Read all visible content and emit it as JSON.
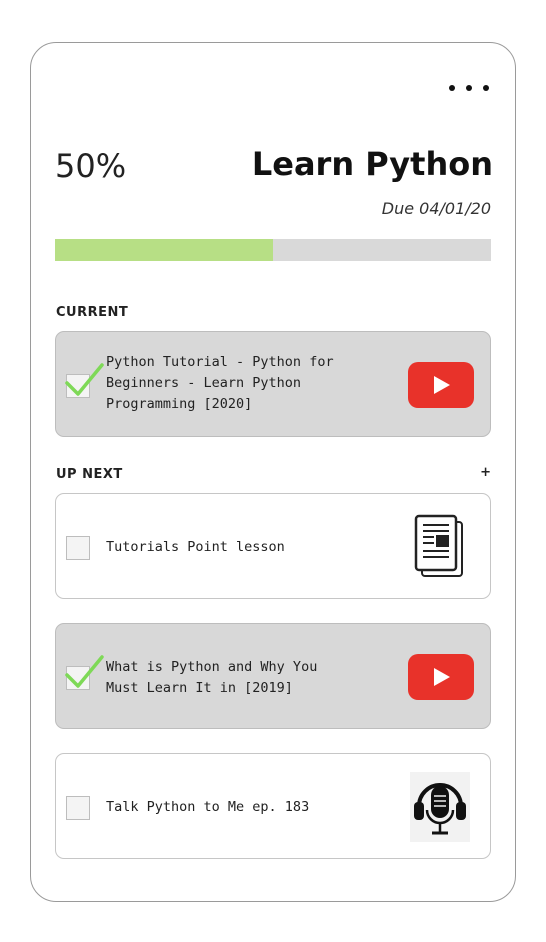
{
  "goal": {
    "progress_label": "50%",
    "progress_fraction": 0.5,
    "title": "Learn Python",
    "due": "Due 04/01/20"
  },
  "colors": {
    "progress_fill": "#b7df85",
    "progress_track": "#d9d9d9",
    "completed_item_bg": "#d8d8d8",
    "checkmark": "#7ed957",
    "youtube_red": "#e8322a"
  },
  "menu": {
    "icon": "more-horizontal-icon"
  },
  "current": {
    "label": "CURRENT",
    "item": {
      "text": "Python Tutorial - Python for Beginners - Learn Python Programming [2020]",
      "completed": true,
      "icon": "youtube-icon"
    }
  },
  "up_next": {
    "label": "UP NEXT",
    "add_label": "+",
    "items": [
      {
        "text": "Tutorials Point lesson",
        "completed": false,
        "icon": "document-icon"
      },
      {
        "text": "What is Python and Why You Must Learn It in [2019]",
        "completed": true,
        "icon": "youtube-icon"
      },
      {
        "text": "Talk Python to Me ep. 183",
        "completed": false,
        "icon": "podcast-icon"
      }
    ]
  }
}
